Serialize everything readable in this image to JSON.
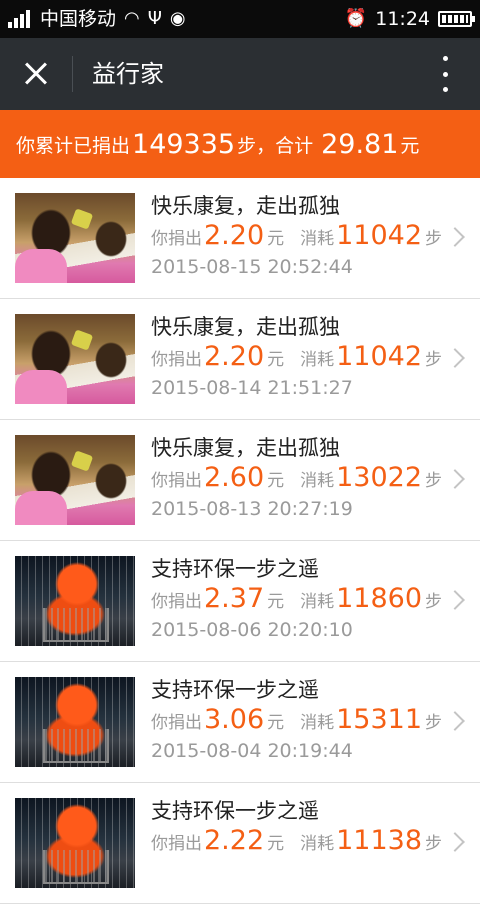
{
  "status_bar": {
    "carrier": "中国移动",
    "time": "11:24",
    "icons": [
      "signal-icon",
      "wifi-icon",
      "usb-icon",
      "wechat-icon",
      "alarm-icon",
      "battery-icon"
    ]
  },
  "header": {
    "title": "益行家",
    "close_icon": "close-icon",
    "more_icon": "more-vertical-icon"
  },
  "summary": {
    "prefix": "你累计已捐出",
    "steps": "149335",
    "steps_unit": "步，合计",
    "total": "29.81",
    "total_unit": "元"
  },
  "labels": {
    "donated": "你捐出",
    "yuan": "元",
    "consumed": "消耗",
    "step": "步"
  },
  "donations": [
    {
      "title": "快乐康复，走出孤独",
      "amount": "2.20",
      "steps": "11042",
      "date": "2015-08-15 20:52:44",
      "image": "kids"
    },
    {
      "title": "快乐康复，走出孤独",
      "amount": "2.20",
      "steps": "11042",
      "date": "2015-08-14 21:51:27",
      "image": "kids"
    },
    {
      "title": "快乐康复，走出孤独",
      "amount": "2.60",
      "steps": "13022",
      "date": "2015-08-13 20:27:19",
      "image": "kids"
    },
    {
      "title": "支持环保一步之遥",
      "amount": "2.37",
      "steps": "11860",
      "date": "2015-08-06 20:20:10",
      "image": "worker"
    },
    {
      "title": "支持环保一步之遥",
      "amount": "3.06",
      "steps": "15311",
      "date": "2015-08-04 20:19:44",
      "image": "worker"
    },
    {
      "title": "支持环保一步之遥",
      "amount": "2.22",
      "steps": "11138",
      "date": "",
      "image": "worker"
    }
  ],
  "colors": {
    "accent": "#f45f14",
    "header_bg": "#2b2f33",
    "status_bg": "#0b0b0b"
  }
}
